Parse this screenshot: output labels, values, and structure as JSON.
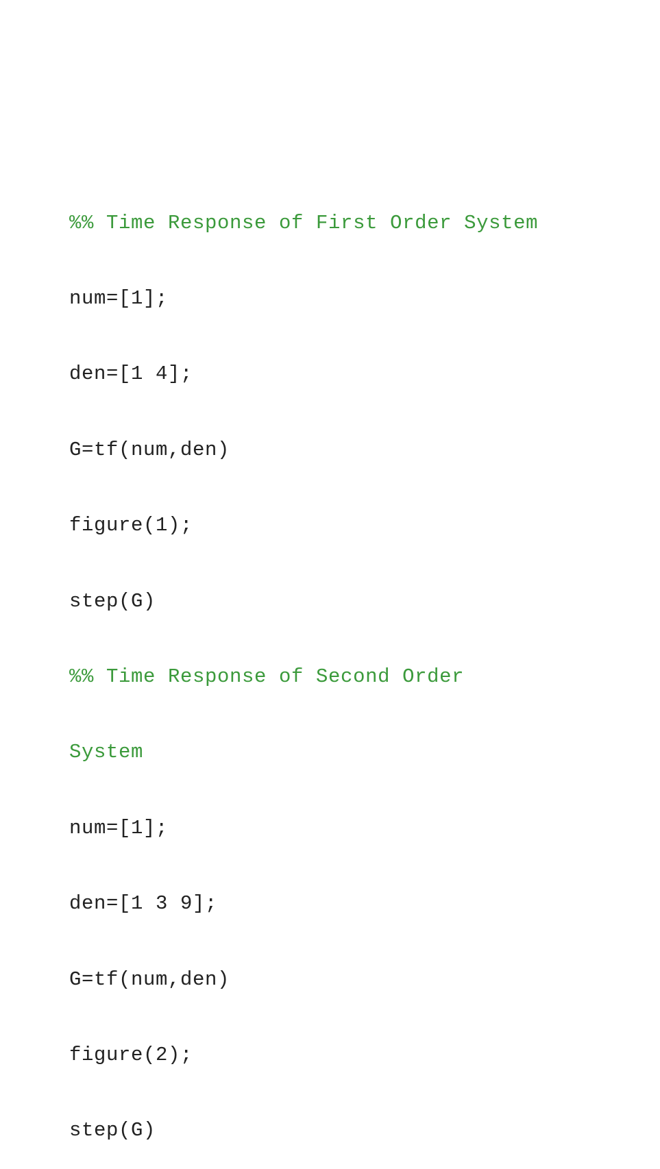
{
  "code": {
    "lines": [
      {
        "text": "%% Time Response of First Order System",
        "kind": "comment"
      },
      {
        "text": "num=[1];",
        "kind": "code"
      },
      {
        "text": "den=[1 4];",
        "kind": "code"
      },
      {
        "text": "G=tf(num,den)",
        "kind": "code"
      },
      {
        "text": "figure(1);",
        "kind": "code"
      },
      {
        "text": "step(G)",
        "kind": "code"
      },
      {
        "text": "%% Time Response of Second Order",
        "kind": "comment"
      },
      {
        "text": "System",
        "kind": "comment"
      },
      {
        "text": "num=[1];",
        "kind": "code"
      },
      {
        "text": "den=[1 3 9];",
        "kind": "code"
      },
      {
        "text": "G=tf(num,den)",
        "kind": "code"
      },
      {
        "text": "figure(2);",
        "kind": "code"
      },
      {
        "text": "step(G)",
        "kind": "code"
      }
    ]
  },
  "colors": {
    "comment": "#3b9a3b",
    "code": "#222222",
    "background": "#ffffff"
  }
}
